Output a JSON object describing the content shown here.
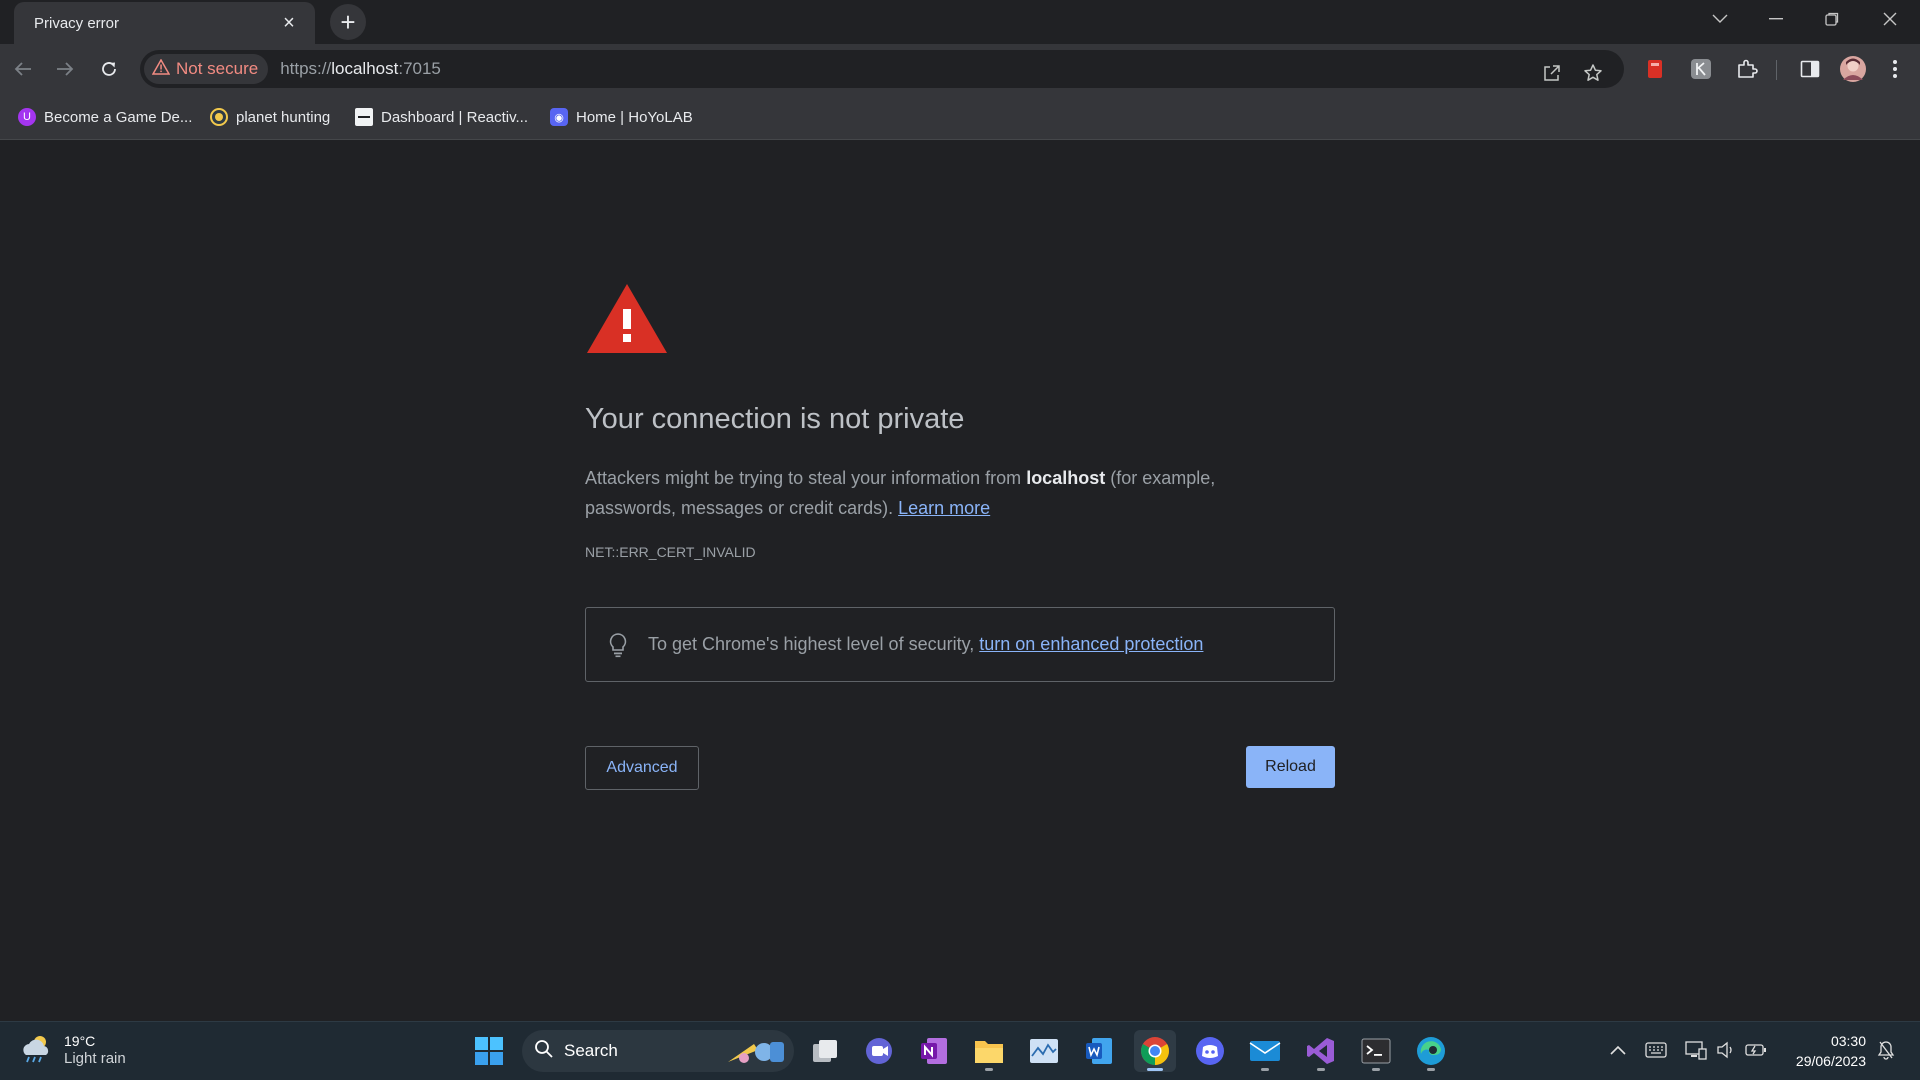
{
  "tab": {
    "title": "Privacy error"
  },
  "toolbar": {
    "security_chip": "Not secure",
    "url_scheme": "https://",
    "url_host": "localhost",
    "url_port": ":7015"
  },
  "bookmarks": [
    {
      "label": "Become a Game De...",
      "icon": "udemy-icon"
    },
    {
      "label": "planet hunting",
      "icon": "planet-icon"
    },
    {
      "label": "Dashboard | Reactiv...",
      "icon": "dashboard-icon"
    },
    {
      "label": "Home | HoYoLAB",
      "icon": "hoyolab-icon"
    }
  ],
  "page": {
    "heading": "Your connection is not private",
    "explain_prefix": "Attackers might be trying to steal your information from ",
    "explain_host": "localhost",
    "explain_suffix": " (for example, passwords, messages or credit cards). ",
    "learn_more": "Learn more",
    "error_code": "NET::ERR_CERT_INVALID",
    "security_text": "To get Chrome's highest level of security, ",
    "security_link": "turn on enhanced protection",
    "advanced_label": "Advanced",
    "reload_label": "Reload"
  },
  "taskbar": {
    "weather_temp": "19°C",
    "weather_desc": "Light rain",
    "search_label": "Search",
    "time": "03:30",
    "date": "29/06/2023"
  },
  "colors": {
    "warning_red": "#d93025",
    "link_blue": "#8ab4f8",
    "page_bg": "#202124",
    "toolbar_bg": "#35363a"
  }
}
